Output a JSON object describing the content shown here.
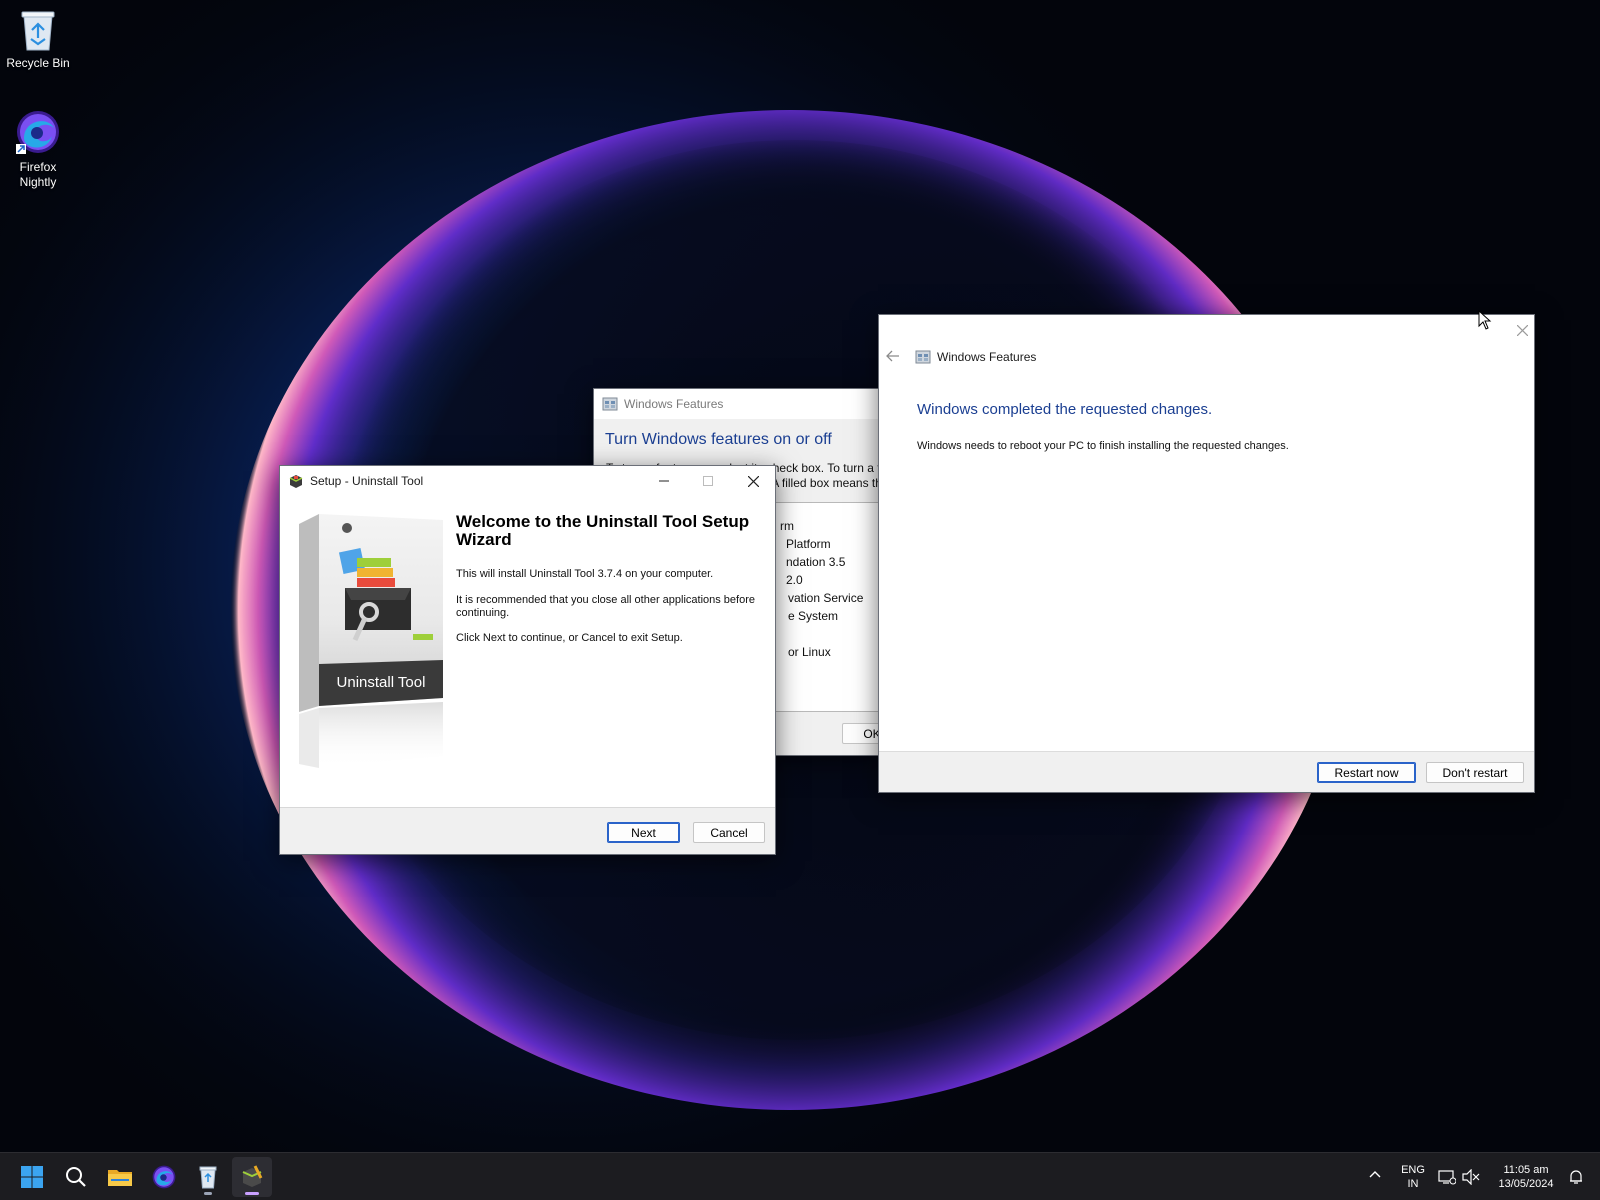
{
  "desktop": {
    "icons": [
      {
        "label": "Recycle Bin"
      },
      {
        "label": "Firefox Nightly"
      }
    ]
  },
  "features_back": {
    "title": "Windows Features",
    "heading": "Turn Windows features on or off",
    "desc_line1": "To turn a feature on, select its check box. To turn a fe",
    "desc_line2": "feature off, clear its check box. A filled box means that only part of the f",
    "list": [
      "rm",
      "Platform",
      "ndation 3.5",
      "2.0",
      "vation Service",
      "e System",
      "or Linux"
    ],
    "ok_label": "OK"
  },
  "setup": {
    "title": "Setup - Uninstall Tool",
    "heading": "Welcome to the Uninstall Tool Setup Wizard",
    "p1": "This will install Uninstall Tool 3.7.4 on your computer.",
    "p2": "It is recommended that you close all other applications before continuing.",
    "p3": "Click Next to continue, or Cancel to exit Setup.",
    "box_label": "Uninstall Tool",
    "next_label": "Next",
    "cancel_label": "Cancel"
  },
  "features_front": {
    "title": "Windows Features",
    "heading": "Windows completed the requested changes.",
    "desc": "Windows needs to reboot your PC to finish installing the requested changes.",
    "restart_label": "Restart now",
    "dont_restart_label": "Don't restart"
  },
  "taskbar": {
    "lang_line1": "ENG",
    "lang_line2": "IN",
    "time": "11:05 am",
    "date": "13/05/2024"
  },
  "colors": {
    "accent": "#1b3f92",
    "default_button_border": "#2a63c9",
    "taskbar_bg": "#1c1c20"
  }
}
